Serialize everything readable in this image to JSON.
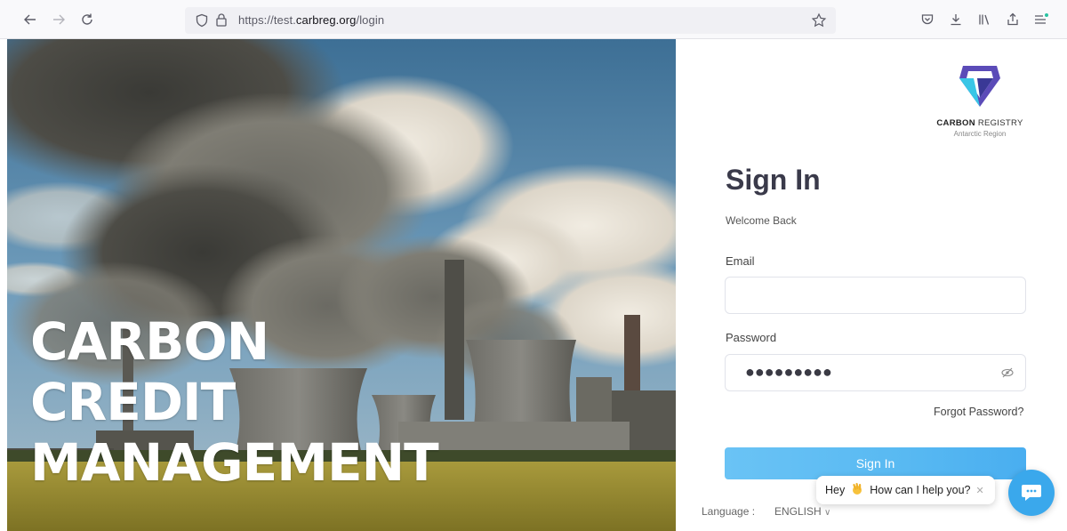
{
  "browser": {
    "url_prefix": "https://test.",
    "url_domain": "carbreg.org",
    "url_path": "/login"
  },
  "hero": {
    "title_lines": [
      "CARBON",
      "CREDIT",
      "MANAGEMENT"
    ]
  },
  "brand": {
    "name_bold": "CARBON",
    "name_rest": " REGISTRY",
    "subtitle": "Antarctic Region"
  },
  "form": {
    "title": "Sign In",
    "subtitle": "Welcome Back",
    "email_label": "Email",
    "email_value": "",
    "password_label": "Password",
    "password_masked": "●●●●●●●●●",
    "forgot_link": "Forgot Password?",
    "signin_button": "Sign In"
  },
  "language": {
    "label": "Language :",
    "value": "ENGLISH"
  },
  "chat": {
    "message": "How can I help you?",
    "greeting": "Hey"
  },
  "colors": {
    "accent": "#4fb4f1",
    "chat": "#3aa8ec",
    "brand_purple": "#5b4bb8",
    "brand_cyan": "#39c6e6"
  }
}
